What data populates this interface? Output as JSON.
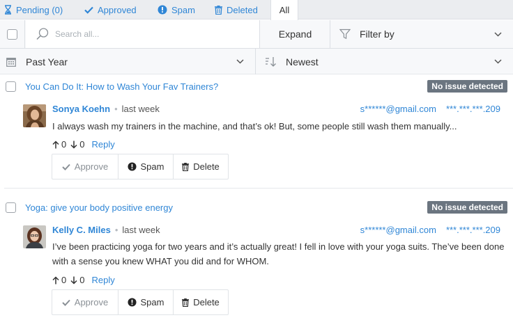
{
  "tabs": [
    {
      "label": "Pending (0)",
      "icon": "hourglass-icon"
    },
    {
      "label": "Approved",
      "icon": "checkmark-icon"
    },
    {
      "label": "Spam",
      "icon": "alert-circle-icon"
    },
    {
      "label": "Deleted",
      "icon": "trash-icon"
    },
    {
      "label": "All",
      "active": true
    }
  ],
  "toolbar": {
    "search_placeholder": "Search all...",
    "expand_label": "Expand",
    "filter_label": "Filter by"
  },
  "sortbar": {
    "period_label": "Past Year",
    "order_label": "Newest"
  },
  "comments": [
    {
      "post_title": "You Can Do It: How to Wash Your Fav Trainers?",
      "badge": "No issue detected",
      "author": "Sonya Koehn",
      "time": "last week",
      "email": "s******@gmail.com",
      "ip": "***.***.***.209",
      "text": "I always wash my trainers in the machine, and that’s ok! But, some people still wash them manually...",
      "upvotes": "0",
      "downvotes": "0",
      "reply_label": "Reply",
      "actions": {
        "approve": "Approve",
        "spam": "Spam",
        "delete": "Delete"
      }
    },
    {
      "post_title": "Yoga: give your body positive energy",
      "badge": "No issue detected",
      "author": "Kelly C. Miles",
      "time": "last week",
      "email": "s******@gmail.com",
      "ip": "***.***.***.209",
      "text": "I’ve been practicing yoga for two years and it’s actually great! I fell in love with your yoga suits. The’ve been done with a sense you knew WHAT you did and for WHOM.",
      "upvotes": "0",
      "downvotes": "0",
      "reply_label": "Reply",
      "actions": {
        "approve": "Approve",
        "spam": "Spam",
        "delete": "Delete"
      }
    }
  ],
  "colors": {
    "link": "#2f86d6",
    "badge_bg": "#6b7580",
    "tabbar_bg": "#ebedf0"
  }
}
